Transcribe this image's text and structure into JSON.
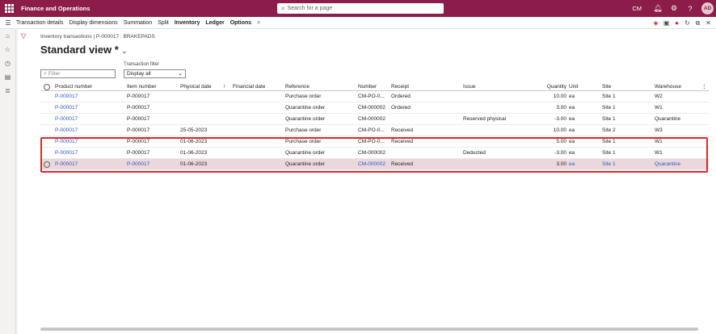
{
  "topbar": {
    "app_title": "Finance and Operations",
    "search_placeholder": "Search for a page",
    "company": "CM",
    "avatar_initials": "AD"
  },
  "actionbar": {
    "items": [
      "Transaction details",
      "Display dimensions",
      "Summation",
      "Split",
      "Inventory",
      "Ledger",
      "Options"
    ]
  },
  "page": {
    "breadcrumb": "Inventory transactions | P-000017 : BRAKEPADS",
    "title": "Standard view *",
    "filter_placeholder": "Filter",
    "transaction_filter_label": "Transaction filter",
    "transaction_filter_value": "Display all"
  },
  "grid": {
    "columns": [
      "Product number",
      "Item number",
      "Physical date",
      "Financial date",
      "Reference",
      "Number",
      "Receipt",
      "Issue",
      "Quantity",
      "Unit",
      "Site",
      "Warehouse"
    ],
    "rows": [
      {
        "product": "P-000017",
        "item": "P-000017",
        "physical_date": "",
        "financial_date": "",
        "reference": "Purchase order",
        "number": "CM-PO-0...",
        "receipt": "Ordered",
        "issue": "",
        "quantity": "10.00",
        "unit": "ea",
        "site": "Site 1",
        "warehouse": "W2"
      },
      {
        "product": "P-000017",
        "item": "P-000017",
        "physical_date": "",
        "financial_date": "",
        "reference": "Quarantine order",
        "number": "CM-000002",
        "receipt": "Ordered",
        "issue": "",
        "quantity": "3.00",
        "unit": "ea",
        "site": "Site 1",
        "warehouse": "W1"
      },
      {
        "product": "P-000017",
        "item": "P-000017",
        "physical_date": "",
        "financial_date": "",
        "reference": "Quarantine order",
        "number": "CM-000002",
        "receipt": "",
        "issue": "Reserved physical",
        "quantity": "-3.00",
        "unit": "ea",
        "site": "Site 1",
        "warehouse": "Quarantine"
      },
      {
        "product": "P-000017",
        "item": "P-000017",
        "physical_date": "25-05-2023",
        "financial_date": "",
        "reference": "Purchase order",
        "number": "CM-PO-0...",
        "receipt": "Received",
        "issue": "",
        "quantity": "10.00",
        "unit": "ea",
        "site": "Site 2",
        "warehouse": "W3"
      },
      {
        "product": "P-000017",
        "item": "P-000017",
        "physical_date": "01-06-2023",
        "financial_date": "",
        "reference": "Purchase order",
        "number": "CM-PO-0...",
        "receipt": "Received",
        "issue": "",
        "quantity": "5.00",
        "unit": "ea",
        "site": "Site 1",
        "warehouse": "W1"
      },
      {
        "product": "P-000017",
        "item": "P-000017",
        "physical_date": "01-06-2023",
        "financial_date": "",
        "reference": "Quarantine order",
        "number": "CM-000002",
        "receipt": "",
        "issue": "Deducted",
        "quantity": "-3.00",
        "unit": "ea",
        "site": "Site 1",
        "warehouse": "W1"
      },
      {
        "product": "P-000017",
        "item": "P-000017",
        "physical_date": "01-06-2023",
        "financial_date": "",
        "reference": "Quarantine order",
        "number": "CM-000002",
        "receipt": "Received",
        "issue": "",
        "quantity": "3.00",
        "unit": "ea",
        "site": "Site 1",
        "warehouse": "Quarantine"
      }
    ]
  },
  "colors": {
    "brand": "#8c1c49",
    "link": "#2b57c4",
    "highlight_border": "#e0262e",
    "selected_row": "#ead8dd"
  }
}
